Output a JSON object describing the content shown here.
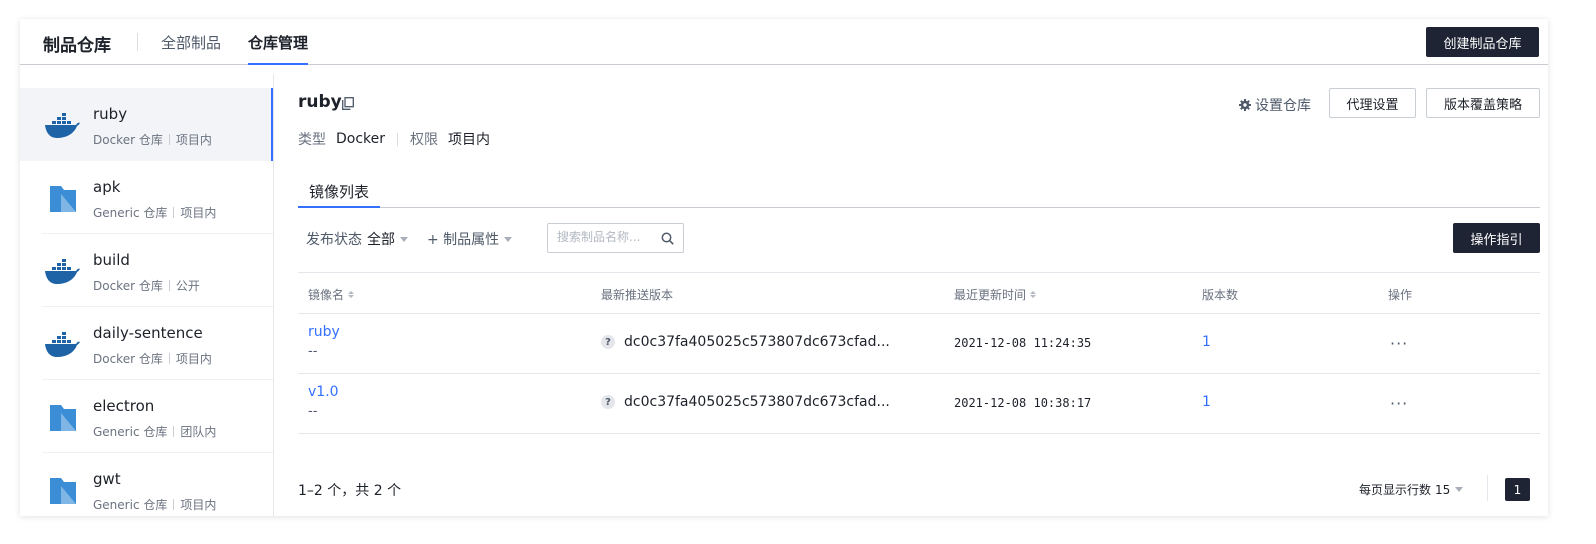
{
  "header": {
    "brand": "制品仓库",
    "tabs": [
      {
        "label": "全部制品",
        "active": false
      },
      {
        "label": "仓库管理",
        "active": true
      }
    ],
    "create_button": "创建制品仓库"
  },
  "sidebar": {
    "items": [
      {
        "name": "ruby",
        "type": "Docker 仓库",
        "scope": "项目内",
        "icon": "docker-icon",
        "active": true
      },
      {
        "name": "apk",
        "type": "Generic 仓库",
        "scope": "项目内",
        "icon": "generic-folder-icon",
        "active": false
      },
      {
        "name": "build",
        "type": "Docker 仓库",
        "scope": "公开",
        "icon": "docker-icon",
        "active": false
      },
      {
        "name": "daily-sentence",
        "type": "Docker 仓库",
        "scope": "项目内",
        "icon": "docker-icon",
        "active": false
      },
      {
        "name": "electron",
        "type": "Generic 仓库",
        "scope": "团队内",
        "icon": "generic-folder-icon",
        "active": false
      },
      {
        "name": "gwt",
        "type": "Generic 仓库",
        "scope": "项目内",
        "icon": "generic-folder-icon",
        "active": false
      }
    ]
  },
  "repo": {
    "title": "ruby",
    "type_label": "类型",
    "type_value": "Docker",
    "perm_label": "权限",
    "perm_value": "项目内",
    "settings_link": "设置仓库",
    "proxy_button": "代理设置",
    "overwrite_button": "版本覆盖策略"
  },
  "tabs": {
    "image_list": "镜像列表"
  },
  "filters": {
    "status_label": "发布状态",
    "status_value": "全部",
    "attr_label": "+ 制品属性",
    "search_placeholder": "搜索制品名称...",
    "guide_button": "操作指引"
  },
  "table": {
    "columns": [
      "镜像名",
      "最新推送版本",
      "最近更新时间",
      "版本数",
      "操作"
    ],
    "rows": [
      {
        "name": "ruby",
        "sub": "--",
        "digest": "dc0c37fa405025c573807dc673cfad...",
        "updated": "2021-12-08 11:24:35",
        "versions": "1",
        "ops": "···"
      },
      {
        "name": "v1.0",
        "sub": "--",
        "digest": "dc0c37fa405025c573807dc673cfad...",
        "updated": "2021-12-08 10:38:17",
        "versions": "1",
        "ops": "···"
      }
    ]
  },
  "pagination": {
    "summary": "1–2 个，共 2 个",
    "page_size_label": "每页显示行数",
    "page_size": "15",
    "current_page": "1"
  },
  "colors": {
    "accent": "#3370ff",
    "dark_button": "#1e2433",
    "docker_blue": "#1d63a6"
  }
}
